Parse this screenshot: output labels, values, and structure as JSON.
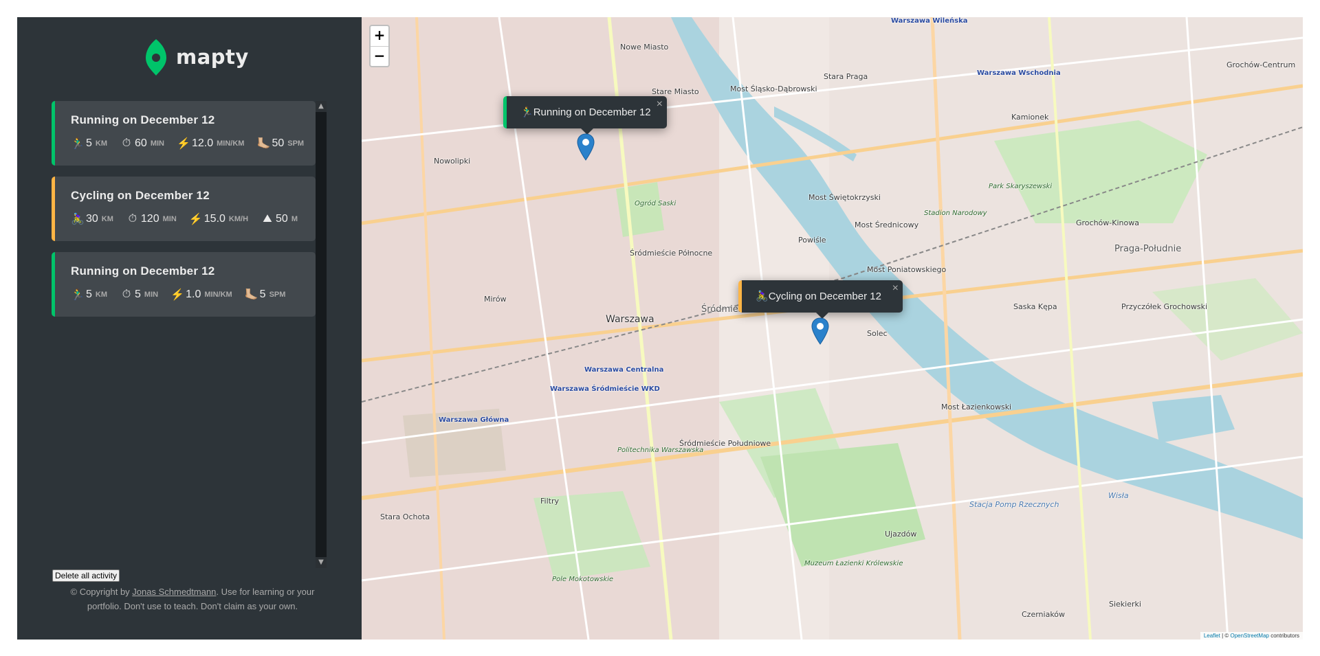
{
  "app": {
    "name": "mapty",
    "brand_color": "#00c46a",
    "cycling_color": "#ffb545",
    "panel_bg": "#2d3439"
  },
  "workouts": [
    {
      "type": "running",
      "title": "Running on December 12",
      "stats": [
        {
          "icon": "🏃‍♂️",
          "value": "5",
          "unit": "km"
        },
        {
          "icon": "⏱",
          "value": "60",
          "unit": "min"
        },
        {
          "icon": "⚡️",
          "value": "12.0",
          "unit": "min/km"
        },
        {
          "icon": "🦶🏼",
          "value": "50",
          "unit": "spm"
        }
      ]
    },
    {
      "type": "cycling",
      "title": "Cycling on December 12",
      "stats": [
        {
          "icon": "🚴‍♀️",
          "value": "30",
          "unit": "km"
        },
        {
          "icon": "⏱",
          "value": "120",
          "unit": "min"
        },
        {
          "icon": "⚡️",
          "value": "15.0",
          "unit": "km/h"
        },
        {
          "icon": "⛰",
          "value": "50",
          "unit": "m"
        }
      ]
    },
    {
      "type": "running",
      "title": "Running on December 12",
      "stats": [
        {
          "icon": "🏃‍♂️",
          "value": "5",
          "unit": "km"
        },
        {
          "icon": "⏱",
          "value": "5",
          "unit": "min"
        },
        {
          "icon": "⚡️",
          "value": "1.0",
          "unit": "min/km"
        },
        {
          "icon": "🦶🏼",
          "value": "5",
          "unit": "spm"
        }
      ]
    }
  ],
  "sidebar": {
    "delete_button": "Delete all activity",
    "copyright_prefix": "© Copyright by ",
    "copyright_author": "Jonas Schmedtmann",
    "copyright_suffix": ". Use for learning or your portfolio. Don't use to teach. Don't claim as your own."
  },
  "map": {
    "zoom_in": "+",
    "zoom_out": "−",
    "popups": [
      {
        "type": "running",
        "icon": "🏃‍♂️",
        "text": "Running on December 12",
        "close": "×"
      },
      {
        "type": "cycling",
        "icon": "🚴‍♀️",
        "text": "Cycling on December 12",
        "close": "×"
      }
    ],
    "attribution": {
      "leaflet": "Leaflet",
      "sep": " | © ",
      "osm": "OpenStreetMap",
      "suffix": " contributors"
    },
    "labels": [
      {
        "text": "Warszawa Wileńska",
        "kind": "station"
      },
      {
        "text": "Nowe Miasto",
        "kind": ""
      },
      {
        "text": "Stare Miasto",
        "kind": ""
      },
      {
        "text": "Most Śląsko-Dąbrowski",
        "kind": ""
      },
      {
        "text": "Stara Praga",
        "kind": ""
      },
      {
        "text": "Warszawa Wschodnia",
        "kind": "station"
      },
      {
        "text": "Grochów-Centrum",
        "kind": ""
      },
      {
        "text": "Kamionek",
        "kind": ""
      },
      {
        "text": "Nowolipki",
        "kind": ""
      },
      {
        "text": "Park Skaryszewski",
        "kind": "park"
      },
      {
        "text": "Most Świętokrzyski",
        "kind": ""
      },
      {
        "text": "Stadion Narodowy",
        "kind": "park"
      },
      {
        "text": "Most Średnicowy",
        "kind": ""
      },
      {
        "text": "Grochów-Kinowa",
        "kind": ""
      },
      {
        "text": "Ogród Saski",
        "kind": "park"
      },
      {
        "text": "Śródmieście Północne",
        "kind": ""
      },
      {
        "text": "Powiśle",
        "kind": ""
      },
      {
        "text": "Praga-Południe",
        "kind": "district"
      },
      {
        "text": "Most Poniatowskiego",
        "kind": ""
      },
      {
        "text": "Mirów",
        "kind": ""
      },
      {
        "text": "Warszawa",
        "kind": "big"
      },
      {
        "text": "Śródmieście",
        "kind": "district"
      },
      {
        "text": "Solec",
        "kind": ""
      },
      {
        "text": "Saska Kępa",
        "kind": ""
      },
      {
        "text": "Przyczółek Grochowski",
        "kind": ""
      },
      {
        "text": "Warszawa Centralna",
        "kind": "station"
      },
      {
        "text": "Warszawa Śródmieście WKD",
        "kind": "station"
      },
      {
        "text": "Warszawa Główna",
        "kind": "station"
      },
      {
        "text": "Most Łazienkowski",
        "kind": ""
      },
      {
        "text": "Śródmieście Południowe",
        "kind": ""
      },
      {
        "text": "Politechnika Warszawska",
        "kind": "park"
      },
      {
        "text": "Filtry",
        "kind": ""
      },
      {
        "text": "Stacja Pomp Rzecznych",
        "kind": "water"
      },
      {
        "text": "Stara Ochota",
        "kind": ""
      },
      {
        "text": "Ujazdów",
        "kind": ""
      },
      {
        "text": "Pole Mokotowskie",
        "kind": "park"
      },
      {
        "text": "Muzeum Łazienki Królewskie",
        "kind": "park"
      },
      {
        "text": "Czerniaków",
        "kind": ""
      },
      {
        "text": "Siekierki",
        "kind": ""
      },
      {
        "text": "Wisła",
        "kind": "water"
      }
    ]
  }
}
